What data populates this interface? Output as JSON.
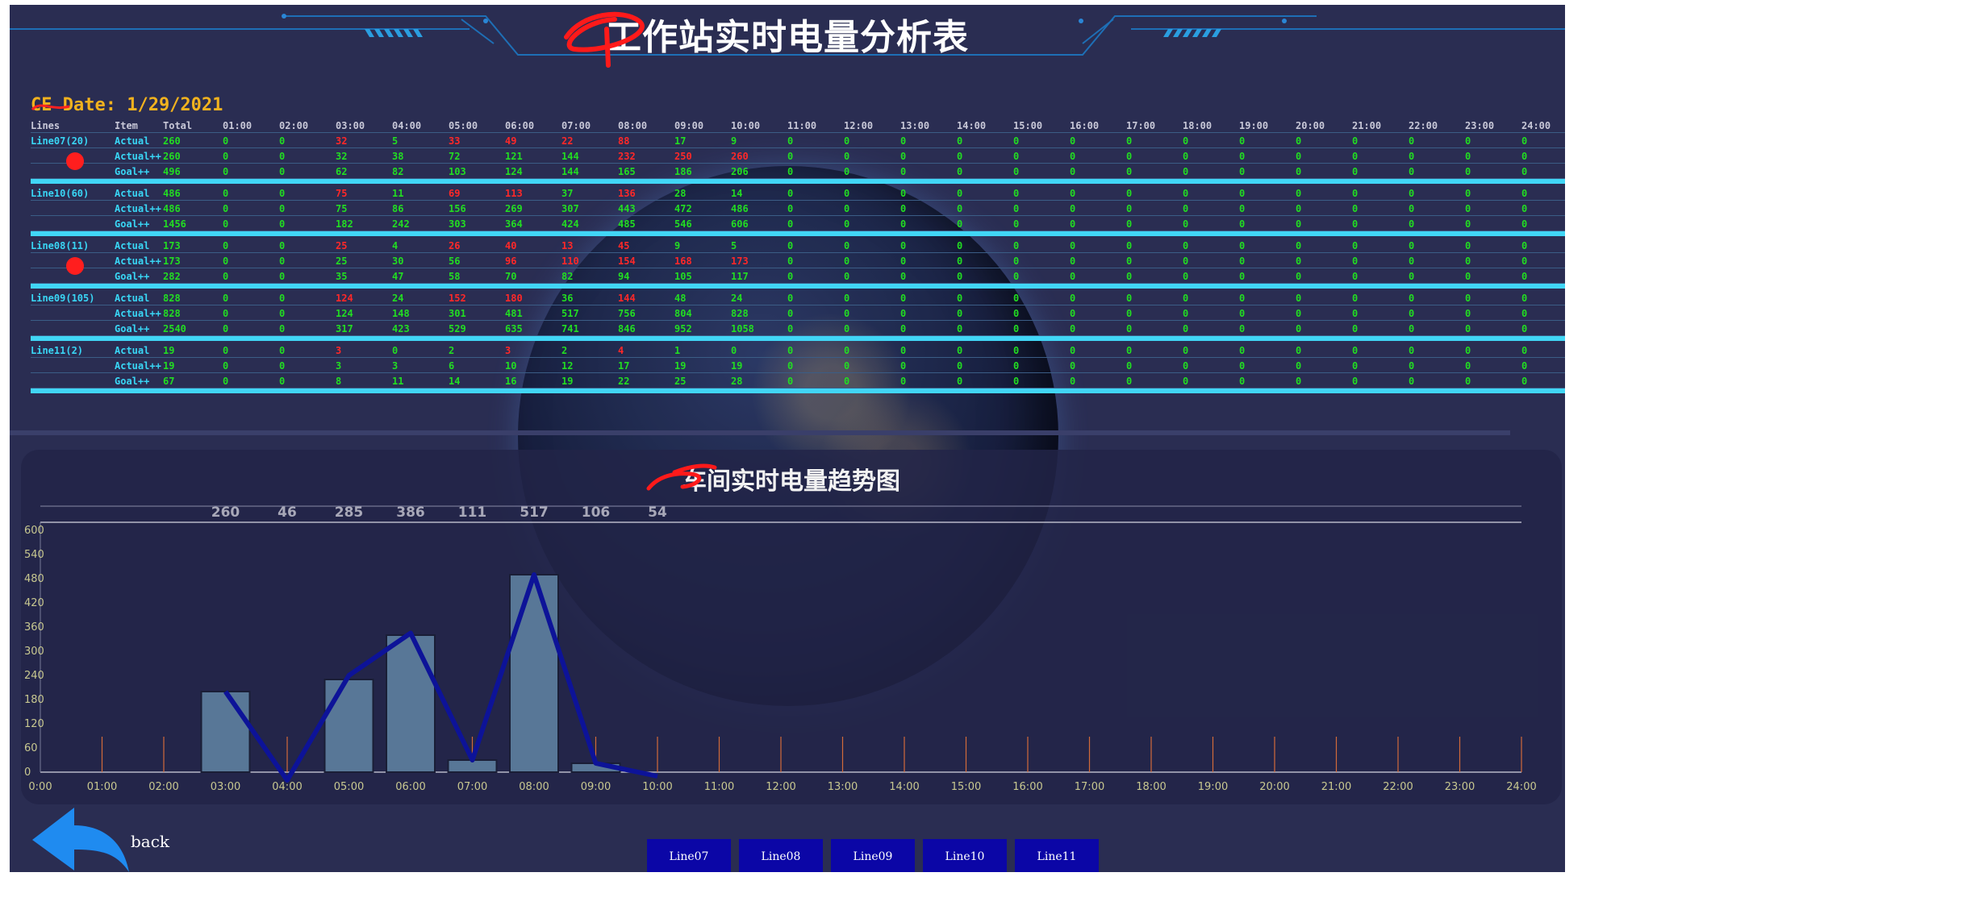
{
  "header": {
    "title": "工作站实时电量分析表"
  },
  "date_label": "CE Date: 1/29/2021",
  "table": {
    "columns": [
      "Lines",
      "Item",
      "Total",
      "01:00",
      "02:00",
      "03:00",
      "04:00",
      "05:00",
      "06:00",
      "07:00",
      "08:00",
      "09:00",
      "10:00",
      "11:00",
      "12:00",
      "13:00",
      "14:00",
      "15:00",
      "16:00",
      "17:00",
      "18:00",
      "19:00",
      "20:00",
      "21:00",
      "22:00",
      "23:00",
      "24:00"
    ],
    "groups": [
      {
        "name": "Line07(20)",
        "dot": true,
        "rows": [
          {
            "item": "Actual",
            "total": "260",
            "values": [
              "0",
              "0",
              "32",
              "5",
              "33",
              "49",
              "22",
              "88",
              "17",
              "9",
              "0",
              "0",
              "0",
              "0",
              "0",
              "0",
              "0",
              "0",
              "0",
              "0",
              "0",
              "0",
              "0",
              "0"
            ],
            "red": [
              2,
              4,
              5,
              6,
              7
            ]
          },
          {
            "item": "Actual++",
            "total": "260",
            "values": [
              "0",
              "0",
              "32",
              "38",
              "72",
              "121",
              "144",
              "232",
              "250",
              "260",
              "0",
              "0",
              "0",
              "0",
              "0",
              "0",
              "0",
              "0",
              "0",
              "0",
              "0",
              "0",
              "0",
              "0"
            ],
            "red": [
              7,
              8,
              9
            ]
          },
          {
            "item": "Goal++",
            "total": "496",
            "values": [
              "0",
              "0",
              "62",
              "82",
              "103",
              "124",
              "144",
              "165",
              "186",
              "206",
              "0",
              "0",
              "0",
              "0",
              "0",
              "0",
              "0",
              "0",
              "0",
              "0",
              "0",
              "0",
              "0",
              "0"
            ],
            "red": []
          }
        ]
      },
      {
        "name": "Line10(60)",
        "dot": false,
        "rows": [
          {
            "item": "Actual",
            "total": "486",
            "values": [
              "0",
              "0",
              "75",
              "11",
              "69",
              "113",
              "37",
              "136",
              "28",
              "14",
              "0",
              "0",
              "0",
              "0",
              "0",
              "0",
              "0",
              "0",
              "0",
              "0",
              "0",
              "0",
              "0",
              "0"
            ],
            "red": [
              2,
              4,
              5,
              7
            ]
          },
          {
            "item": "Actual++",
            "total": "486",
            "values": [
              "0",
              "0",
              "75",
              "86",
              "156",
              "269",
              "307",
              "443",
              "472",
              "486",
              "0",
              "0",
              "0",
              "0",
              "0",
              "0",
              "0",
              "0",
              "0",
              "0",
              "0",
              "0",
              "0",
              "0"
            ],
            "red": []
          },
          {
            "item": "Goal++",
            "total": "1456",
            "values": [
              "0",
              "0",
              "182",
              "242",
              "303",
              "364",
              "424",
              "485",
              "546",
              "606",
              "0",
              "0",
              "0",
              "0",
              "0",
              "0",
              "0",
              "0",
              "0",
              "0",
              "0",
              "0",
              "0",
              "0"
            ],
            "red": []
          }
        ]
      },
      {
        "name": "Line08(11)",
        "dot": true,
        "rows": [
          {
            "item": "Actual",
            "total": "173",
            "values": [
              "0",
              "0",
              "25",
              "4",
              "26",
              "40",
              "13",
              "45",
              "9",
              "5",
              "0",
              "0",
              "0",
              "0",
              "0",
              "0",
              "0",
              "0",
              "0",
              "0",
              "0",
              "0",
              "0",
              "0"
            ],
            "red": [
              2,
              4,
              5,
              6,
              7
            ]
          },
          {
            "item": "Actual++",
            "total": "173",
            "values": [
              "0",
              "0",
              "25",
              "30",
              "56",
              "96",
              "110",
              "154",
              "168",
              "173",
              "0",
              "0",
              "0",
              "0",
              "0",
              "0",
              "0",
              "0",
              "0",
              "0",
              "0",
              "0",
              "0",
              "0"
            ],
            "red": [
              5,
              6,
              7,
              8,
              9
            ]
          },
          {
            "item": "Goal++",
            "total": "282",
            "values": [
              "0",
              "0",
              "35",
              "47",
              "58",
              "70",
              "82",
              "94",
              "105",
              "117",
              "0",
              "0",
              "0",
              "0",
              "0",
              "0",
              "0",
              "0",
              "0",
              "0",
              "0",
              "0",
              "0",
              "0"
            ],
            "red": []
          }
        ]
      },
      {
        "name": "Line09(105)",
        "dot": false,
        "rows": [
          {
            "item": "Actual",
            "total": "828",
            "values": [
              "0",
              "0",
              "124",
              "24",
              "152",
              "180",
              "36",
              "144",
              "48",
              "24",
              "0",
              "0",
              "0",
              "0",
              "0",
              "0",
              "0",
              "0",
              "0",
              "0",
              "0",
              "0",
              "0",
              "0"
            ],
            "red": [
              2,
              4,
              5,
              7
            ]
          },
          {
            "item": "Actual++",
            "total": "828",
            "values": [
              "0",
              "0",
              "124",
              "148",
              "301",
              "481",
              "517",
              "756",
              "804",
              "828",
              "0",
              "0",
              "0",
              "0",
              "0",
              "0",
              "0",
              "0",
              "0",
              "0",
              "0",
              "0",
              "0",
              "0"
            ],
            "red": []
          },
          {
            "item": "Goal++",
            "total": "2540",
            "values": [
              "0",
              "0",
              "317",
              "423",
              "529",
              "635",
              "741",
              "846",
              "952",
              "1058",
              "0",
              "0",
              "0",
              "0",
              "0",
              "0",
              "0",
              "0",
              "0",
              "0",
              "0",
              "0",
              "0",
              "0"
            ],
            "red": []
          }
        ]
      },
      {
        "name": "Line11(2)",
        "dot": false,
        "rows": [
          {
            "item": "Actual",
            "total": "19",
            "values": [
              "0",
              "0",
              "3",
              "0",
              "2",
              "3",
              "2",
              "4",
              "1",
              "0",
              "0",
              "0",
              "0",
              "0",
              "0",
              "0",
              "0",
              "0",
              "0",
              "0",
              "0",
              "0",
              "0",
              "0"
            ],
            "red": [
              2,
              5,
              7
            ]
          },
          {
            "item": "Actual++",
            "total": "19",
            "values": [
              "0",
              "0",
              "3",
              "3",
              "6",
              "10",
              "12",
              "17",
              "19",
              "19",
              "0",
              "0",
              "0",
              "0",
              "0",
              "0",
              "0",
              "0",
              "0",
              "0",
              "0",
              "0",
              "0",
              "0"
            ],
            "red": []
          },
          {
            "item": "Goal++",
            "total": "67",
            "values": [
              "0",
              "0",
              "8",
              "11",
              "14",
              "16",
              "19",
              "22",
              "25",
              "28",
              "0",
              "0",
              "0",
              "0",
              "0",
              "0",
              "0",
              "0",
              "0",
              "0",
              "0",
              "0",
              "0",
              "0"
            ],
            "red": []
          }
        ]
      }
    ]
  },
  "chart_data": {
    "type": "bar",
    "title": "车间实时电量趋势图",
    "categories": [
      "0:00",
      "01:00",
      "02:00",
      "03:00",
      "04:00",
      "05:00",
      "06:00",
      "07:00",
      "08:00",
      "09:00",
      "10:00",
      "11:00",
      "12:00",
      "13:00",
      "14:00",
      "15:00",
      "16:00",
      "17:00",
      "18:00",
      "19:00",
      "20:00",
      "21:00",
      "22:00",
      "23:00",
      "24:00"
    ],
    "series": [
      {
        "values": [
          0,
          0,
          0,
          200,
          0,
          230,
          340,
          30,
          490,
          22,
          0,
          0,
          0,
          0,
          0,
          0,
          0,
          0,
          0,
          0,
          0,
          0,
          0,
          0,
          0
        ]
      },
      {
        "values": [
          null,
          null,
          null,
          200,
          -20,
          240,
          345,
          30,
          490,
          22,
          -10,
          null,
          null,
          null,
          null,
          null,
          null,
          null,
          null,
          null,
          null,
          null,
          null,
          null,
          null
        ]
      }
    ],
    "top_labels": [
      "260",
      "46",
      "285",
      "386",
      "111",
      "517",
      "106",
      "54"
    ],
    "yticks": [
      "0",
      "60",
      "120",
      "180",
      "240",
      "300",
      "360",
      "420",
      "480",
      "540",
      "600"
    ],
    "ylim": [
      0,
      600
    ],
    "colors": {
      "bar": "#587797",
      "line": "#0d1398",
      "axis": "#c8c890",
      "tick": "#d26a3a"
    }
  },
  "footer": {
    "back_label": "back",
    "line_buttons": [
      "Line07",
      "Line08",
      "Line09",
      "Line10",
      "Line11"
    ]
  }
}
